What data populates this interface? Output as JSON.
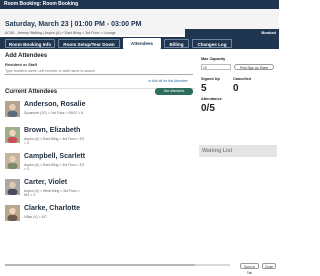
{
  "window": {
    "title": "Room Booking: Room Booking"
  },
  "header": {
    "title": "Saturday, March 23 | 01:00 PM - 03:00 PM",
    "subtitle": "AC08 - Jeremy Watling | Aspen (A) > East Wing > 3rd Floor > Lounge",
    "bar_label": "Booked"
  },
  "tabs": [
    {
      "label": "Room Booking Info"
    },
    {
      "label": "Room Setup/Tear Down"
    },
    {
      "label": "Attendees"
    },
    {
      "label": "Billing"
    },
    {
      "label": "Changes Log"
    }
  ],
  "add_attendees": {
    "title": "Add Attendees",
    "field_label": "Resident or Staff",
    "placeholder": "Type resident name, unit number or staff name to search",
    "add_all_link": "or Add all for this Attendee"
  },
  "current_attendees": {
    "title": "Current Attendees",
    "see_button": "See Attendees"
  },
  "attendees": [
    {
      "name": "Anderson, Rosalie",
      "info": "Sycamore (SC) > 3rd Floor > RU02 > A"
    },
    {
      "name": "Brown, Elizabeth",
      "info": "Aspen (A) > East Wing > 3rd Floor > E3 > 3"
    },
    {
      "name": "Campbell, Scarlett",
      "info": "Aspen (A) > East Wing > 3rd Floor > E3 > 3"
    },
    {
      "name": "Carter, Violet",
      "info": "Aspen (A) > West Wing > 3rd Floor > W3 > 3"
    },
    {
      "name": "Clarke, Charlotte",
      "info": "Villas (V) > 107"
    }
  ],
  "sidebar": {
    "max_capacity_label": "Max Capacity",
    "max_capacity_value": "10",
    "print_button": "Print Sign Up Sheet",
    "signed_up_label": "Signed Up",
    "signed_up_value": "5",
    "cancelled_label": "Cancelled",
    "cancelled_value": "0",
    "attendance_label": "Attendance",
    "attendance_value": "0/5",
    "waiting_list_label": "Waiting List"
  },
  "footer": {
    "open_tab": "Open in Tab",
    "close": "Close"
  }
}
